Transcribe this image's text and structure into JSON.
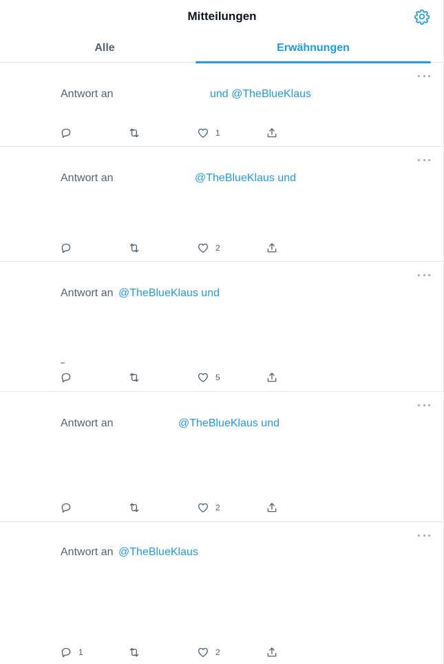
{
  "header": {
    "title": "Mitteilungen",
    "settings_icon": "gear-icon"
  },
  "tabs": [
    {
      "label": "Alle",
      "active": false
    },
    {
      "label": "Erwähnungen",
      "active": true
    }
  ],
  "colors": {
    "accent": "#1d9bf0",
    "secondary_text": "#536471",
    "divider": "#e6e6e6"
  },
  "tweets": [
    {
      "reply_prefix": "Antwort an",
      "handles": "und @TheBlueKlaus",
      "counts": {
        "reply": "",
        "retweet": "",
        "like": "1"
      }
    },
    {
      "reply_prefix": "Antwort an",
      "handles": "@TheBlueKlaus und",
      "counts": {
        "reply": "",
        "retweet": "",
        "like": "2"
      }
    },
    {
      "reply_prefix": "Antwort an",
      "handles": "@TheBlueKlaus und",
      "counts": {
        "reply": "",
        "retweet": "",
        "like": "5"
      }
    },
    {
      "reply_prefix": "Antwort an",
      "handles": "@TheBlueKlaus und",
      "counts": {
        "reply": "",
        "retweet": "",
        "like": "2"
      }
    },
    {
      "reply_prefix": "Antwort an",
      "handles": "@TheBlueKlaus",
      "counts": {
        "reply": "1",
        "retweet": "",
        "like": "2"
      }
    }
  ]
}
